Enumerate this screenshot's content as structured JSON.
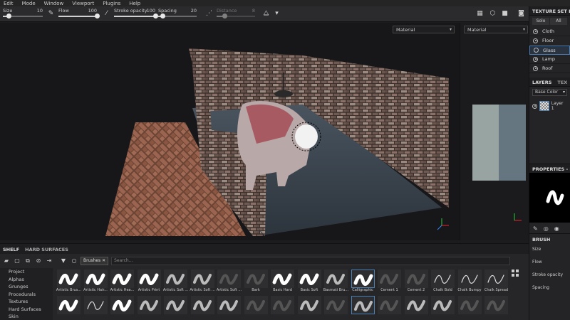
{
  "menu": [
    "Edit",
    "Mode",
    "Window",
    "Viewport",
    "Plugins",
    "Help"
  ],
  "toolbar": {
    "size": {
      "label": "Size",
      "value": "10",
      "fraction": 0.15
    },
    "flow": {
      "label": "Flow",
      "value": "100",
      "fraction": 1.0
    },
    "stroke_opacity": {
      "label": "Stroke opacity",
      "value": "100",
      "fraction": 1.0
    },
    "spacing": {
      "label": "Spacing",
      "value": "20",
      "fraction": 0.12
    },
    "distance": {
      "label": "Distance",
      "value": "8",
      "fraction": 0.2
    }
  },
  "viewport": {
    "material_left": "Material",
    "material_right": "Material"
  },
  "texture_sets": {
    "title": "TEXTURE SET LIST",
    "solo": "Solo",
    "all": "All",
    "items": [
      {
        "label": "Cloth",
        "selected": false
      },
      {
        "label": "Floor",
        "selected": false
      },
      {
        "label": "Glass",
        "selected": true
      },
      {
        "label": "Lamp",
        "selected": false
      },
      {
        "label": "Roof",
        "selected": false
      }
    ]
  },
  "layers": {
    "tab_layers": "LAYERS",
    "tab_other": "TEX",
    "channel": "Base Color",
    "layer_name": "Layer 1"
  },
  "properties": {
    "title": "PROPERTIES - PAI",
    "section": "BRUSH",
    "rows": [
      "Size",
      "Flow",
      "Stroke opacity",
      "Spacing"
    ]
  },
  "shelf": {
    "tab_shelf": "SHELF",
    "tab_hard": "HARD SURFACES",
    "filter_chip": "Brushes",
    "search_placeholder": "Search...",
    "categories": [
      "Project",
      "Alphas",
      "Grunges",
      "Procedurals",
      "Textures",
      "Hard Surfaces",
      "Skin"
    ],
    "brushes_row1": [
      "Artistic Brus...",
      "Artistic Hair...",
      "Artistic Hea...",
      "Artistic Print",
      "Artistic Soft ...",
      "Artistic Soft ...",
      "Artistic Soft ...",
      "Bark",
      "Basic Hard",
      "Basic Soft",
      "Basmati Bru...",
      "Calligraphic",
      "Cement 1",
      "Cement 2",
      "Chalk Bold",
      "Chalk Bumpy",
      "Chalk Spread"
    ],
    "selected_index": 11
  }
}
